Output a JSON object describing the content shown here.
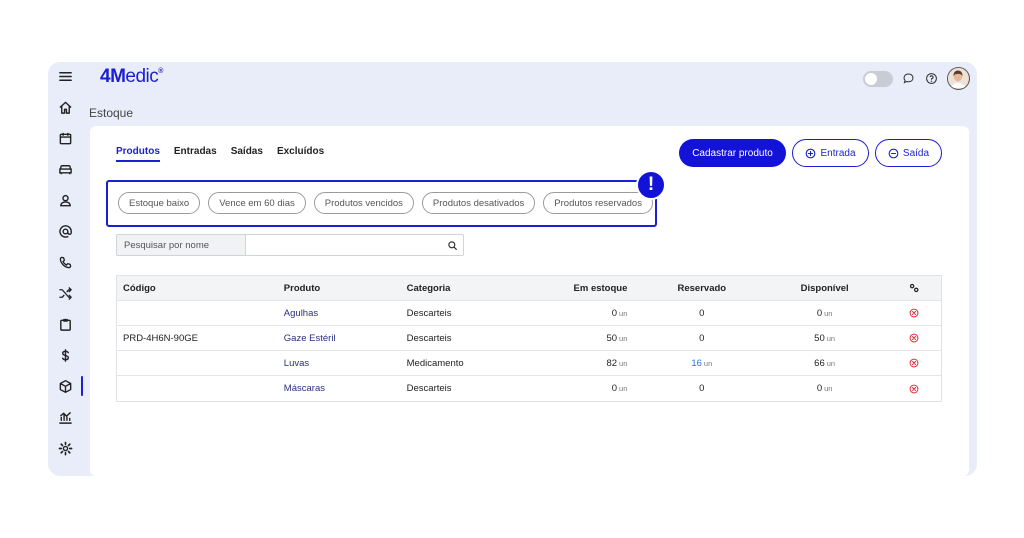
{
  "app": {
    "logo_main": "4M",
    "logo_rest": "edic",
    "logo_mark": "®"
  },
  "header": {
    "page_title": "Estoque"
  },
  "sidebar": {
    "items": [
      {
        "icon": "menu-icon"
      },
      {
        "icon": "home-icon"
      },
      {
        "icon": "calendar-icon"
      },
      {
        "icon": "couch-icon"
      },
      {
        "icon": "user-icon"
      },
      {
        "icon": "at-icon"
      },
      {
        "icon": "phone-icon"
      },
      {
        "icon": "shuffle-icon"
      },
      {
        "icon": "clipboard-icon"
      },
      {
        "icon": "dollar-icon"
      },
      {
        "icon": "box-icon",
        "active": true
      },
      {
        "icon": "chart-icon"
      },
      {
        "icon": "gear-icon"
      }
    ]
  },
  "tabs": [
    "Produtos",
    "Entradas",
    "Saídas",
    "Excluídos"
  ],
  "actions": {
    "primary": "Cadastrar produto",
    "entrada": "Entrada",
    "saida": "Saída"
  },
  "filters": [
    "Estoque baixo",
    "Vence em 60 dias",
    "Produtos vencidos",
    "Produtos desativados",
    "Produtos reservados"
  ],
  "alert_mark": "!",
  "search": {
    "label": "Pesquisar por nome",
    "placeholder": "",
    "value": ""
  },
  "table": {
    "headers": [
      "Código",
      "Produto",
      "Categoria",
      "Em estoque",
      "Reservado",
      "Disponível"
    ],
    "unit": "un",
    "rows": [
      {
        "codigo": "",
        "produto": "Agulhas",
        "categoria": "Descarteis",
        "estoque": "0",
        "reservado": "0",
        "reservado_unit": false,
        "disponivel": "0"
      },
      {
        "codigo": "PRD-4H6N-90GE",
        "produto": "Gaze Estéril",
        "categoria": "Descarteis",
        "estoque": "50",
        "reservado": "0",
        "reservado_unit": false,
        "disponivel": "50"
      },
      {
        "codigo": "",
        "produto": "Luvas",
        "categoria": "Medicamento",
        "estoque": "82",
        "reservado": "16",
        "reservado_unit": true,
        "disponivel": "66"
      },
      {
        "codigo": "",
        "produto": "Máscaras",
        "categoria": "Descarteis",
        "estoque": "0",
        "reservado": "0",
        "reservado_unit": false,
        "disponivel": "0"
      }
    ]
  },
  "colors": {
    "brand": "#1a1fd1",
    "primary_button": "#1313d8",
    "frame_bg": "#e9edfa",
    "delete": "#e0303a",
    "link": "#2f6fd6"
  }
}
